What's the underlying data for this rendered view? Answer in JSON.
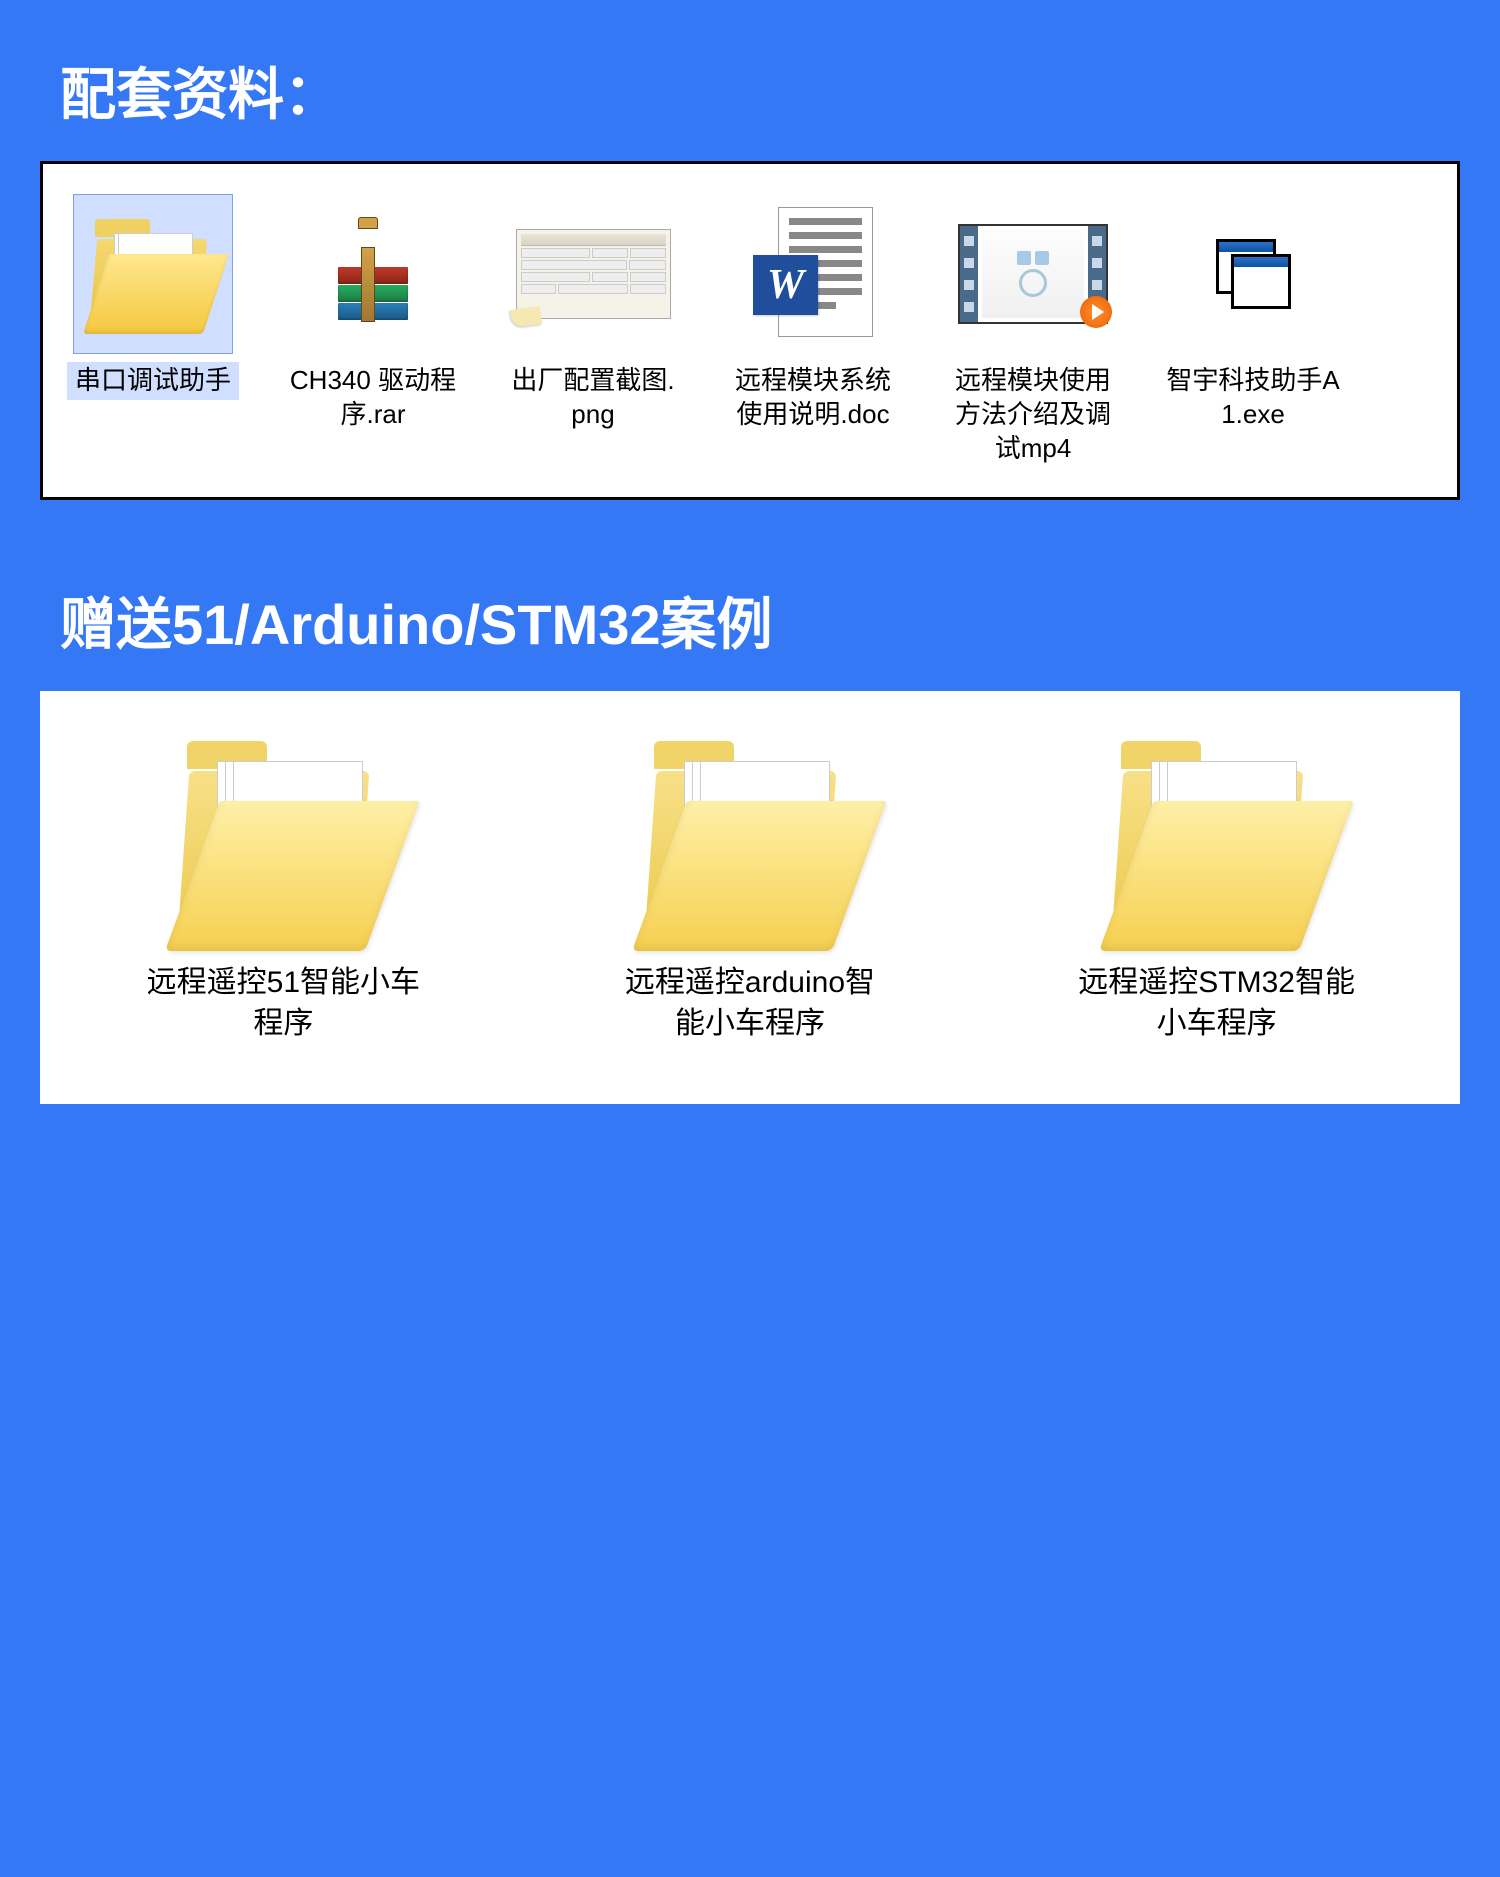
{
  "section1": {
    "title": "配套资料：",
    "files": [
      {
        "label": "串口调试助手",
        "icon": "folder",
        "selected": true
      },
      {
        "label": "CH340 驱动程序.rar",
        "icon": "rar",
        "selected": false
      },
      {
        "label": "出厂配置截图.png",
        "icon": "png",
        "selected": false
      },
      {
        "label": "远程模块系统使用说明.doc",
        "icon": "doc",
        "selected": false
      },
      {
        "label": "远程模块使用方法介绍及调试mp4",
        "icon": "video",
        "selected": false
      },
      {
        "label": "智宇科技助手A1.exe",
        "icon": "exe",
        "selected": false
      }
    ]
  },
  "section2": {
    "title": "赠送51/Arduino/STM32案例",
    "files": [
      {
        "label": "远程遥控51智能小车程序",
        "icon": "folder"
      },
      {
        "label": "远程遥控arduino智能小车程序",
        "icon": "folder"
      },
      {
        "label": "远程遥控STM32智能小车程序",
        "icon": "folder"
      }
    ]
  }
}
